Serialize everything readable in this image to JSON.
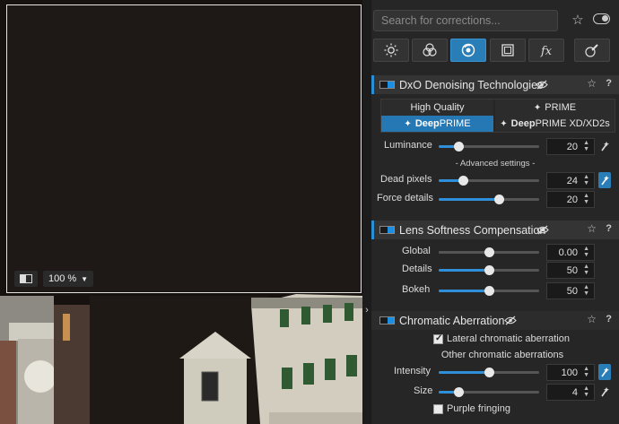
{
  "viewer": {
    "zoom_label": "100 %",
    "collapse_arrow": "›"
  },
  "search": {
    "placeholder": "Search for corrections..."
  },
  "tabs": [
    {
      "icon": "sun-icon",
      "active": false
    },
    {
      "icon": "color-circles-icon",
      "active": false
    },
    {
      "icon": "lens-detail-icon",
      "active": true
    },
    {
      "icon": "geometry-icon",
      "active": false
    },
    {
      "icon": "fx-icon",
      "active": false
    },
    {
      "icon": "local-adjustments-icon",
      "active": false
    }
  ],
  "denoising": {
    "title": "DxO Denoising Technologies",
    "modes": {
      "high_quality": "High Quality",
      "prime": "PRIME",
      "deepprime_bold": "Deep",
      "deepprime_rest": "PRIME",
      "xd_bold": "Deep",
      "xd_rest": "PRIME XD/XD2s"
    },
    "selected_mode": "DeepPRIME",
    "luminance": {
      "label": "Luminance",
      "value": "20",
      "fraction": 0.2
    },
    "advanced": "- Advanced settings -",
    "dead_pixels": {
      "label": "Dead pixels",
      "value": "24",
      "fraction": 0.24
    },
    "force_details": {
      "label": "Force details",
      "value": "20",
      "fraction": 0.6
    }
  },
  "lens_softness": {
    "title": "Lens Softness Compensation",
    "global": {
      "label": "Global",
      "value": "0.00",
      "fraction": 0.5
    },
    "details": {
      "label": "Details",
      "value": "50",
      "fraction": 0.5
    },
    "bokeh": {
      "label": "Bokeh",
      "value": "50",
      "fraction": 0.5
    }
  },
  "chromatic": {
    "title": "Chromatic Aberration",
    "lateral_label": "Lateral chromatic aberration",
    "lateral_checked": true,
    "other_label": "Other chromatic aberrations",
    "intensity": {
      "label": "Intensity",
      "value": "100",
      "fraction": 0.5
    },
    "size": {
      "label": "Size",
      "value": "4",
      "fraction": 0.2
    },
    "purple_label": "Purple fringing",
    "purple_checked": false
  },
  "colors": {
    "accent": "#2a7eb8",
    "panel": "#262626",
    "header": "#343434"
  }
}
